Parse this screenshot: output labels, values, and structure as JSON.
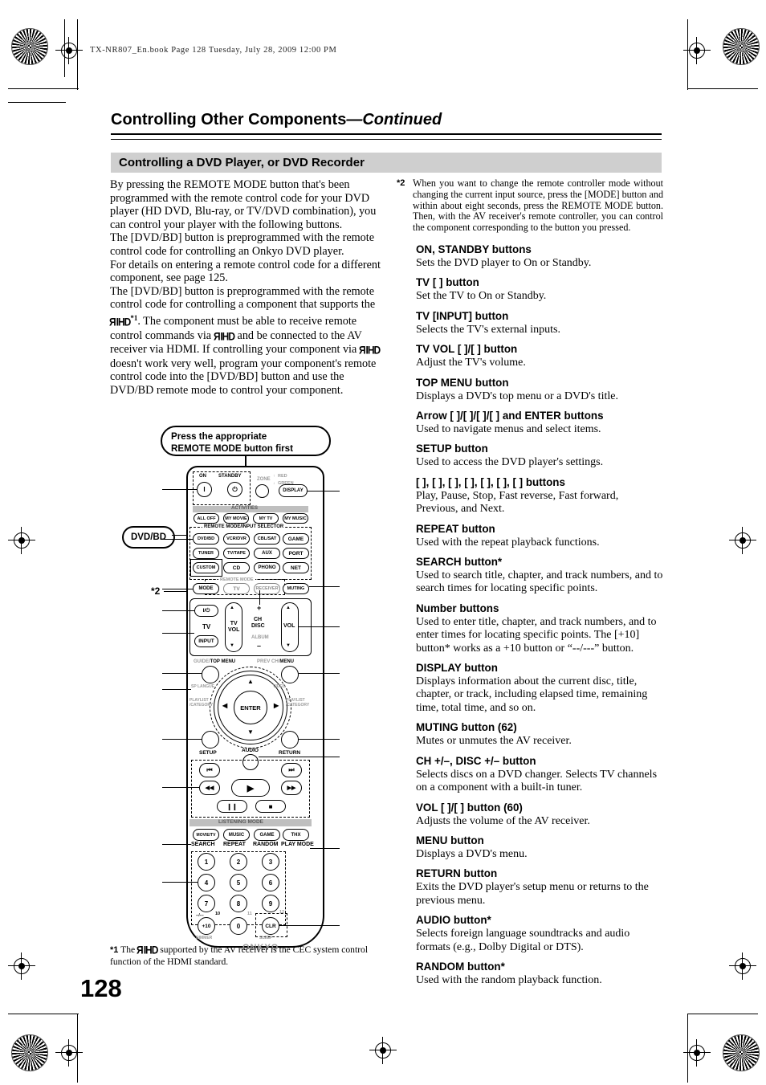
{
  "file_header": "TX-NR807_En.book  Page 128  Tuesday, July 28, 2009  12:00 PM",
  "page_number": "128",
  "chapter": {
    "title_main": "Controlling Other Components",
    "title_cont": "—Continued"
  },
  "section_heading": "Controlling a DVD Player, or DVD Recorder",
  "left_column": {
    "p1": "By pressing the REMOTE MODE button that's been programmed with the remote control code for your DVD player (HD DVD, Blu-ray, or TV/DVD combination), you can control your player with the following buttons.",
    "p2": "The [DVD/BD] button is preprogrammed with the remote control code for controlling an Onkyo DVD player.",
    "p3": "For details on entering a remote control code for a different component, see page 125.",
    "p4_a": "The [DVD/BD] button is preprogrammed with the remote control code for controlling a component that supports the ",
    "p4_b": ". The component must be able to receive remote control commands via ",
    "p4_c": " and be connected to the AV receiver via HDMI. If controlling your component via ",
    "p4_d": " doesn't work very well, program your component's remote control code into the [DVD/BD] button and use the DVD/BD remote mode to control your component.",
    "rihd_logo": "RIHD",
    "footnote_mark_1": "*1"
  },
  "callout": {
    "line1": "Press the appropriate",
    "line2": "REMOTE MODE button first"
  },
  "footnote": {
    "mark": "*1",
    "text_before": "The ",
    "logo": "RIHD",
    "text_after": " supported by the AV receiver is the CEC system control function of the HDMI standard."
  },
  "right_column": {
    "footnote2": {
      "mark": "*2",
      "text": "When you want to change the remote controller mode without changing the current input source, press the [MODE] button and within about eight seconds, press the REMOTE MODE button. Then, with the AV receiver's remote controller, you can control the component corresponding to the button you pressed."
    },
    "entries": [
      {
        "heading": "ON, STANDBY buttons",
        "body": "Sets the DVD player to On or Standby."
      },
      {
        "heading": "TV [    ] button",
        "body": "Set the TV to On or Standby."
      },
      {
        "heading": "TV [INPUT] button",
        "body": "Selects the TV's external inputs."
      },
      {
        "heading": "TV VOL [   ]/[   ] button",
        "body": "Adjust the TV's volume."
      },
      {
        "heading": "TOP MENU button",
        "body": "Displays a DVD's top menu or a DVD's title."
      },
      {
        "heading": "Arrow [   ]/[   ]/[    ]/[   ] and ENTER buttons",
        "body": "Used to navigate menus and select items."
      },
      {
        "heading": "SETUP button",
        "body": "Used to access the DVD player's settings."
      },
      {
        "heading": "[    ], [   ], [   ], [      ], [      ], [      ], [      ] buttons",
        "body": "Play, Pause, Stop, Fast reverse, Fast forward, Previous, and Next."
      },
      {
        "heading": "REPEAT button",
        "body": "Used with the repeat playback functions."
      },
      {
        "heading": "SEARCH button*",
        "body": "Used to search title, chapter, and track numbers, and to search times for locating specific points."
      },
      {
        "heading": "Number buttons",
        "body": "Used to enter title, chapter, and track numbers, and to enter times for locating specific points. The [+10] button* works as a +10 button or “--/---” button."
      },
      {
        "heading": "DISPLAY button",
        "body": "Displays information about the current disc, title, chapter, or track, including elapsed time, remaining time, total time, and so on."
      },
      {
        "heading": "MUTING button (62)",
        "body": "Mutes or unmutes the AV receiver."
      },
      {
        "heading": "CH +/–, DISC +/– button",
        "body": "Selects discs on a DVD changer. Selects TV channels on a component with a built-in tuner."
      },
      {
        "heading": "VOL [   ]/[   ] button (60)",
        "body": "Adjusts the volume of the AV receiver."
      },
      {
        "heading": "MENU button",
        "body": "Displays a DVD's menu."
      },
      {
        "heading": "RETURN button",
        "body": "Exits the DVD player's setup menu or returns to the previous menu."
      },
      {
        "heading": "AUDIO button*",
        "body": "Selects foreign language soundtracks and audio formats (e.g., Dolby Digital or DTS)."
      },
      {
        "heading": "RANDOM button*",
        "body": "Used with the random playback function."
      }
    ]
  },
  "diagram": {
    "side_labels": {
      "dvd_bd": "DVD/BD",
      "footnote2": "*2"
    },
    "remote": {
      "on_label": "ON",
      "standby_label": "STANDBY",
      "on_glyph": "I",
      "standby_glyph": "⏻",
      "zone_label": "ZONE",
      "zone_red": "RED",
      "zone_green": "GREEN",
      "zone_up": "↑",
      "zone_down": "↓",
      "display_btn": "DISPLAY",
      "activities_label": "ACTIVITIES",
      "activity_buttons": [
        "ALL OFF",
        "MY MOVIE",
        "MY TV",
        "MY MUSIC"
      ],
      "selector_label": "REMOTE MODE/INPUT SELECTOR",
      "selector_row1": [
        "DVD/BD",
        "VCR/DVR",
        "CBL/SAT",
        "GAME"
      ],
      "selector_row2": [
        "TUNER",
        "TV/TAPE",
        "AUX",
        "PORT"
      ],
      "selector_row3": [
        "CUSTOM",
        "CD",
        "PHONO",
        "NET"
      ],
      "remote_mode_label": "REMOTE MODE",
      "row_mode": [
        "MODE",
        "TV",
        "RECEIVER",
        "MUTING"
      ],
      "tv_power_glyph": "I/⏻",
      "tv_label": "TV",
      "tv_input": "INPUT",
      "tv_vol_label": "TV\nVOL",
      "ch_plus": "+",
      "ch_label": "CH",
      "disc_label": "DISC",
      "album_label": "ALBUM",
      "ch_minus": "–",
      "vol_label": "VOL",
      "up_arrow": "▲",
      "down_arrow": "▼",
      "guide_label": "GUIDE/",
      "top_menu_label": "TOP MENU",
      "prev_ch_label": "PREV CH/",
      "menu_label": "MENU",
      "sp_lang": "SP LANGUE",
      "video_label": "VIDEO",
      "playlist_left": "PLAYLIST\n/CATEGORY",
      "playlist_right": "PLAYLIST\n/CATEGORY",
      "enter_label": "ENTER",
      "setup_label": "SETUP",
      "audio_label": "AUDIO",
      "return_label": "RETURN",
      "prev_glyph": "⏮",
      "next_glyph": "⏭",
      "rew_glyph": "◀◀",
      "ff_glyph": "▶▶",
      "play_glyph": "▶",
      "pause_glyph": "❙❙",
      "stop_glyph": "■",
      "listening_mode_label": "LISTENING MODE",
      "listening_buttons": [
        "MOVIE/TV",
        "MUSIC",
        "GAME",
        "THX"
      ],
      "listening_sublabels": [
        "SEARCH",
        "REPEAT",
        "RANDOM",
        "PLAY MODE"
      ],
      "numbers": [
        "1",
        "2",
        "3",
        "4",
        "5",
        "6",
        "7",
        "8",
        "9",
        "+10",
        "0",
        "CLR"
      ],
      "num_plus10_top": "--/---",
      "num_10": "10",
      "num_11": "11",
      "num_12": "12",
      "dimmer_label": "DIMMER",
      "sleep_label": "SLEEP",
      "brand": "ONKYO"
    }
  },
  "colors": {
    "section_bar": "#cfcfcf",
    "grey_label": "#9a9a9a",
    "ink": "#000000"
  }
}
